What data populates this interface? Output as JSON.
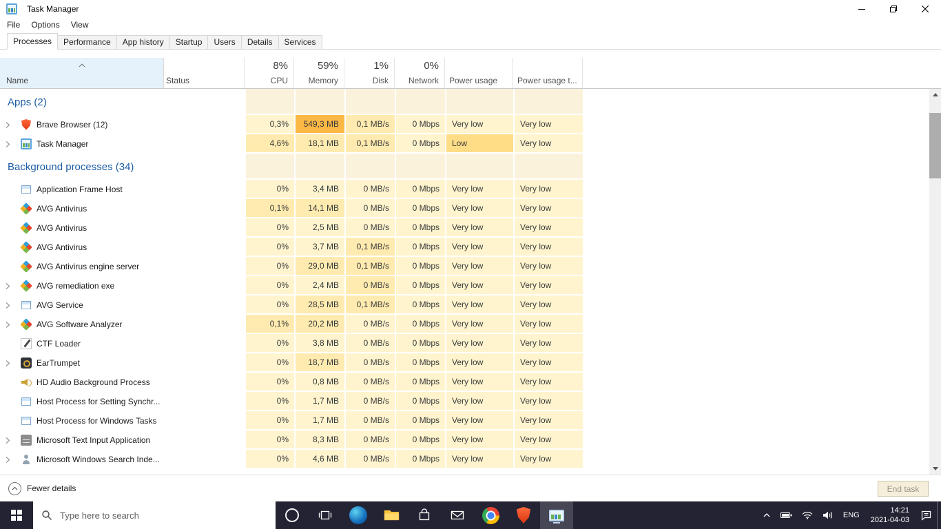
{
  "colors": {
    "heat_idle": "#FBF2DC",
    "heat_low": "#FFF4CE",
    "heat_mid": "#FFEBB0",
    "heat_high": "#FFDD87",
    "heat_peak": "#FBB845",
    "group_label": "#1E5DA6",
    "name_header_bg": "#E5F2FB",
    "taskbar_bg": "#232334"
  },
  "titlebar": {
    "title": "Task Manager"
  },
  "menubar": {
    "items": [
      "File",
      "Options",
      "View"
    ]
  },
  "tabs": {
    "active": "Processes",
    "items": [
      "Processes",
      "Performance",
      "App history",
      "Startup",
      "Users",
      "Details",
      "Services"
    ]
  },
  "header": {
    "name": "Name",
    "status": "Status",
    "cols": [
      {
        "pct": "8%",
        "label": "CPU",
        "align": "right"
      },
      {
        "pct": "59%",
        "label": "Memory",
        "align": "right"
      },
      {
        "pct": "1%",
        "label": "Disk",
        "align": "right"
      },
      {
        "pct": "0%",
        "label": "Network",
        "align": "right"
      },
      {
        "pct": "",
        "label": "Power usage",
        "align": "left"
      },
      {
        "pct": "",
        "label": "Power usage t...",
        "align": "left"
      }
    ]
  },
  "groups": [
    {
      "label": "Apps (2)",
      "rows": [
        {
          "name": "Brave Browser (12)",
          "icon": "brave-shield",
          "expand": true,
          "cells": [
            [
              "0,3%",
              1
            ],
            [
              "549,3 MB",
              4
            ],
            [
              "0,1 MB/s",
              2
            ],
            [
              "0 Mbps",
              1
            ],
            [
              "Very low",
              1
            ],
            [
              "Very low",
              1
            ]
          ]
        },
        {
          "name": "Task Manager",
          "icon": "task-manager",
          "expand": true,
          "cells": [
            [
              "4,6%",
              2
            ],
            [
              "18,1 MB",
              2
            ],
            [
              "0,1 MB/s",
              2
            ],
            [
              "0 Mbps",
              1
            ],
            [
              "Low",
              3
            ],
            [
              "Very low",
              1
            ]
          ]
        }
      ]
    },
    {
      "label": "Background processes (34)",
      "rows": [
        {
          "name": "Application Frame Host",
          "icon": "app-window",
          "expand": false,
          "cells": [
            [
              "0%",
              1
            ],
            [
              "3,4 MB",
              1
            ],
            [
              "0 MB/s",
              1
            ],
            [
              "0 Mbps",
              1
            ],
            [
              "Very low",
              1
            ],
            [
              "Very low",
              1
            ]
          ]
        },
        {
          "name": "AVG Antivirus",
          "icon": "avg-logo",
          "expand": false,
          "cells": [
            [
              "0,1%",
              2
            ],
            [
              "14,1 MB",
              2
            ],
            [
              "0 MB/s",
              1
            ],
            [
              "0 Mbps",
              1
            ],
            [
              "Very low",
              1
            ],
            [
              "Very low",
              1
            ]
          ]
        },
        {
          "name": "AVG Antivirus",
          "icon": "avg-logo",
          "expand": false,
          "cells": [
            [
              "0%",
              1
            ],
            [
              "2,5 MB",
              1
            ],
            [
              "0 MB/s",
              1
            ],
            [
              "0 Mbps",
              1
            ],
            [
              "Very low",
              1
            ],
            [
              "Very low",
              1
            ]
          ]
        },
        {
          "name": "AVG Antivirus",
          "icon": "avg-logo",
          "expand": false,
          "cells": [
            [
              "0%",
              1
            ],
            [
              "3,7 MB",
              1
            ],
            [
              "0,1 MB/s",
              2
            ],
            [
              "0 Mbps",
              1
            ],
            [
              "Very low",
              1
            ],
            [
              "Very low",
              1
            ]
          ]
        },
        {
          "name": "AVG Antivirus engine server",
          "icon": "avg-logo",
          "expand": false,
          "cells": [
            [
              "0%",
              1
            ],
            [
              "29,0 MB",
              2
            ],
            [
              "0,1 MB/s",
              2
            ],
            [
              "0 Mbps",
              1
            ],
            [
              "Very low",
              1
            ],
            [
              "Very low",
              1
            ]
          ]
        },
        {
          "name": "AVG remediation exe",
          "icon": "avg-logo",
          "expand": true,
          "cells": [
            [
              "0%",
              1
            ],
            [
              "2,4 MB",
              1
            ],
            [
              "0 MB/s",
              2
            ],
            [
              "0 Mbps",
              1
            ],
            [
              "Very low",
              1
            ],
            [
              "Very low",
              1
            ]
          ]
        },
        {
          "name": "AVG Service",
          "icon": "app-window",
          "expand": true,
          "cells": [
            [
              "0%",
              1
            ],
            [
              "28,5 MB",
              2
            ],
            [
              "0,1 MB/s",
              2
            ],
            [
              "0 Mbps",
              1
            ],
            [
              "Very low",
              1
            ],
            [
              "Very low",
              1
            ]
          ]
        },
        {
          "name": "AVG Software Analyzer",
          "icon": "avg-logo",
          "expand": true,
          "cells": [
            [
              "0,1%",
              2
            ],
            [
              "20,2 MB",
              2
            ],
            [
              "0 MB/s",
              1
            ],
            [
              "0 Mbps",
              1
            ],
            [
              "Very low",
              1
            ],
            [
              "Very low",
              1
            ]
          ]
        },
        {
          "name": "CTF Loader",
          "icon": "pen",
          "expand": false,
          "cells": [
            [
              "0%",
              1
            ],
            [
              "3,8 MB",
              1
            ],
            [
              "0 MB/s",
              1
            ],
            [
              "0 Mbps",
              1
            ],
            [
              "Very low",
              1
            ],
            [
              "Very low",
              1
            ]
          ]
        },
        {
          "name": "EarTrumpet",
          "icon": "eartrumpet",
          "expand": true,
          "cells": [
            [
              "0%",
              1
            ],
            [
              "18,7 MB",
              2
            ],
            [
              "0 MB/s",
              1
            ],
            [
              "0 Mbps",
              1
            ],
            [
              "Very low",
              1
            ],
            [
              "Very low",
              1
            ]
          ]
        },
        {
          "name": "HD Audio Background Process",
          "icon": "speaker",
          "expand": false,
          "cells": [
            [
              "0%",
              1
            ],
            [
              "0,8 MB",
              1
            ],
            [
              "0 MB/s",
              1
            ],
            [
              "0 Mbps",
              1
            ],
            [
              "Very low",
              1
            ],
            [
              "Very low",
              1
            ]
          ]
        },
        {
          "name": "Host Process for Setting Synchr...",
          "icon": "app-window",
          "expand": false,
          "cells": [
            [
              "0%",
              1
            ],
            [
              "1,7 MB",
              1
            ],
            [
              "0 MB/s",
              1
            ],
            [
              "0 Mbps",
              1
            ],
            [
              "Very low",
              1
            ],
            [
              "Very low",
              1
            ]
          ]
        },
        {
          "name": "Host Process for Windows Tasks",
          "icon": "app-window",
          "expand": false,
          "cells": [
            [
              "0%",
              1
            ],
            [
              "1,7 MB",
              1
            ],
            [
              "0 MB/s",
              1
            ],
            [
              "0 Mbps",
              1
            ],
            [
              "Very low",
              1
            ],
            [
              "Very low",
              1
            ]
          ]
        },
        {
          "name": "Microsoft Text Input Application",
          "icon": "keyboard",
          "expand": true,
          "cells": [
            [
              "0%",
              1
            ],
            [
              "8,3 MB",
              1
            ],
            [
              "0 MB/s",
              1
            ],
            [
              "0 Mbps",
              1
            ],
            [
              "Very low",
              1
            ],
            [
              "Very low",
              1
            ]
          ]
        },
        {
          "name": "Microsoft Windows Search Inde...",
          "icon": "search-user",
          "expand": true,
          "cells": [
            [
              "0%",
              1
            ],
            [
              "4,6 MB",
              1
            ],
            [
              "0 MB/s",
              1
            ],
            [
              "0 Mbps",
              1
            ],
            [
              "Very low",
              1
            ],
            [
              "Very low",
              1
            ]
          ]
        }
      ]
    }
  ],
  "footer": {
    "toggle": "Fewer details",
    "end_task": "End task"
  },
  "taskbar": {
    "search_placeholder": "Type here to search",
    "lang": "ENG",
    "time": "14:21",
    "date": "2021-04-03"
  }
}
